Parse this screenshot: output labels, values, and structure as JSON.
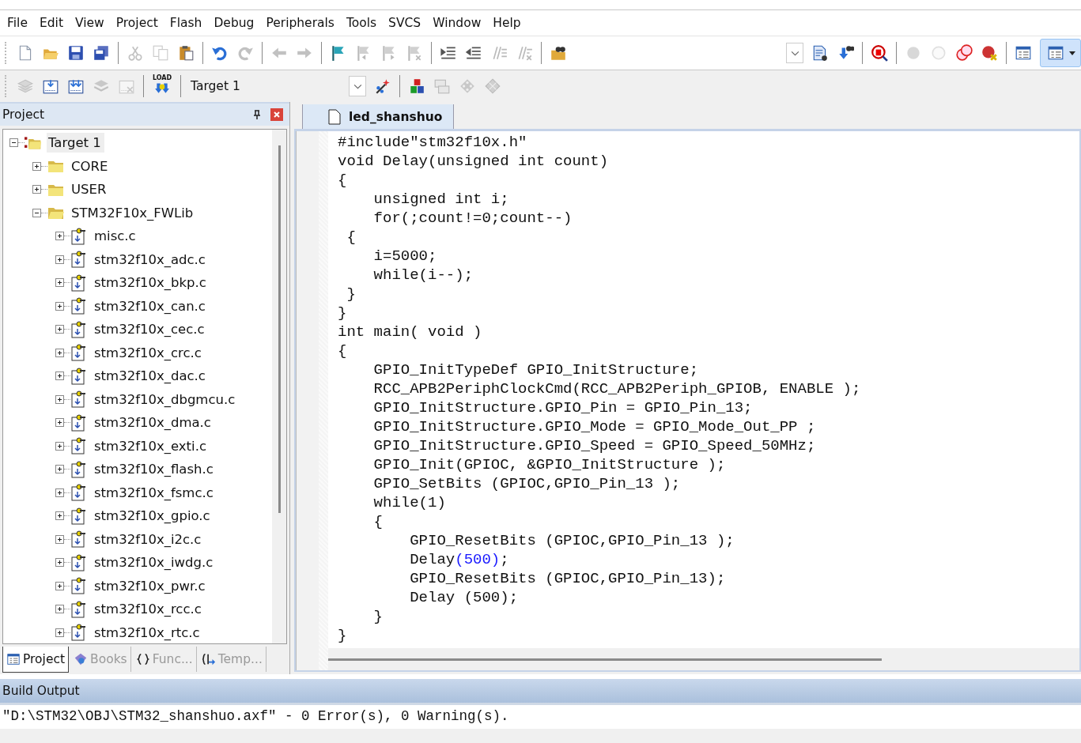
{
  "menu": [
    "File",
    "Edit",
    "View",
    "Project",
    "Flash",
    "Debug",
    "Peripherals",
    "Tools",
    "SVCS",
    "Window",
    "Help"
  ],
  "toolbar": {
    "main": [
      {
        "disabled": false
      },
      {
        "disabled": false
      },
      {
        "disabled": false
      },
      {
        "disabled": false
      },
      {
        "disabled": true
      },
      {
        "disabled": true
      },
      {
        "disabled": false
      },
      {
        "disabled": false
      },
      {
        "disabled": true
      },
      {
        "disabled": true
      },
      {
        "disabled": true
      },
      {
        "disabled": false
      },
      {
        "disabled": true
      },
      {
        "disabled": true
      },
      {
        "disabled": true
      },
      {
        "disabled": false
      },
      {
        "disabled": false
      },
      {
        "disabled": true
      },
      {
        "disabled": true
      },
      {
        "disabled": false
      }
    ],
    "right": [
      {
        "disabled": false
      },
      {
        "disabled": false
      },
      {
        "disabled": false
      },
      {
        "disabled": true
      },
      {
        "disabled": true
      },
      {
        "disabled": false
      },
      {
        "disabled": false
      },
      {
        "disabled": false
      }
    ],
    "build": [
      {
        "disabled": true
      },
      {
        "disabled": false
      },
      {
        "disabled": false
      },
      {
        "disabled": true
      },
      {
        "disabled": true
      }
    ],
    "load_label": "LOAD",
    "target": "Target 1",
    "tools": [
      {
        "disabled": false
      },
      {
        "disabled": false
      },
      {
        "disabled": true
      },
      {
        "disabled": true
      },
      {
        "disabled": true
      }
    ]
  },
  "project_panel": {
    "title": "Project",
    "tree": [
      {
        "label": "Target 1",
        "kind": "target",
        "expanded": true,
        "selected": true,
        "children": [
          {
            "label": "CORE",
            "kind": "folder",
            "expanded": false,
            "selected": false
          },
          {
            "label": "USER",
            "kind": "folder",
            "expanded": false,
            "selected": false
          },
          {
            "label": "STM32F10x_FWLib",
            "kind": "folder",
            "expanded": true,
            "selected": false,
            "children": [
              {
                "label": "misc.c",
                "kind": "file",
                "expanded": false,
                "selected": false
              },
              {
                "label": "stm32f10x_adc.c",
                "kind": "file",
                "expanded": false,
                "selected": false
              },
              {
                "label": "stm32f10x_bkp.c",
                "kind": "file",
                "expanded": false,
                "selected": false
              },
              {
                "label": "stm32f10x_can.c",
                "kind": "file",
                "expanded": false,
                "selected": false
              },
              {
                "label": "stm32f10x_cec.c",
                "kind": "file",
                "expanded": false,
                "selected": false
              },
              {
                "label": "stm32f10x_crc.c",
                "kind": "file",
                "expanded": false,
                "selected": false
              },
              {
                "label": "stm32f10x_dac.c",
                "kind": "file",
                "expanded": false,
                "selected": false
              },
              {
                "label": "stm32f10x_dbgmcu.c",
                "kind": "file",
                "expanded": false,
                "selected": false
              },
              {
                "label": "stm32f10x_dma.c",
                "kind": "file",
                "expanded": false,
                "selected": false
              },
              {
                "label": "stm32f10x_exti.c",
                "kind": "file",
                "expanded": false,
                "selected": false
              },
              {
                "label": "stm32f10x_flash.c",
                "kind": "file",
                "expanded": false,
                "selected": false
              },
              {
                "label": "stm32f10x_fsmc.c",
                "kind": "file",
                "expanded": false,
                "selected": false
              },
              {
                "label": "stm32f10x_gpio.c",
                "kind": "file",
                "expanded": false,
                "selected": false
              },
              {
                "label": "stm32f10x_i2c.c",
                "kind": "file",
                "expanded": false,
                "selected": false
              },
              {
                "label": "stm32f10x_iwdg.c",
                "kind": "file",
                "expanded": false,
                "selected": false
              },
              {
                "label": "stm32f10x_pwr.c",
                "kind": "file",
                "expanded": false,
                "selected": false
              },
              {
                "label": "stm32f10x_rcc.c",
                "kind": "file",
                "expanded": false,
                "selected": false
              },
              {
                "label": "stm32f10x_rtc.c",
                "kind": "file",
                "expanded": false,
                "selected": false
              }
            ]
          }
        ]
      }
    ],
    "tabs": [
      {
        "label": "Project",
        "selected": true
      },
      {
        "label": "Books",
        "selected": false
      },
      {
        "label": "Func...",
        "selected": false
      },
      {
        "label": "Temp...",
        "selected": false
      }
    ]
  },
  "editor": {
    "tabs": [
      {
        "label": "led_shanshuo",
        "selected": true
      }
    ],
    "lines": [
      [
        {
          "text": "#include\"stm32f10x.h\"",
          "kind": "plain"
        }
      ],
      [
        {
          "text": "void Delay(unsigned int count)",
          "kind": "plain"
        }
      ],
      [
        {
          "text": "{",
          "kind": "plain"
        }
      ],
      [
        {
          "text": "    unsigned int i;",
          "kind": "plain"
        }
      ],
      [
        {
          "text": "    for(;count!=0;count--)",
          "kind": "plain"
        }
      ],
      [
        {
          "text": " {",
          "kind": "plain"
        }
      ],
      [
        {
          "text": "    i=5000;",
          "kind": "plain"
        }
      ],
      [
        {
          "text": "    while(i--);",
          "kind": "plain"
        }
      ],
      [
        {
          "text": " }",
          "kind": "plain"
        }
      ],
      [
        {
          "text": "}",
          "kind": "plain"
        }
      ],
      [
        {
          "text": "int main( void )",
          "kind": "plain"
        }
      ],
      [
        {
          "text": "{",
          "kind": "plain"
        }
      ],
      [
        {
          "text": "    GPIO_InitTypeDef GPIO_InitStructure;",
          "kind": "plain"
        }
      ],
      [
        {
          "text": "    RCC_APB2PeriphClockCmd(RCC_APB2Periph_GPIOB, ENABLE );",
          "kind": "plain"
        }
      ],
      [
        {
          "text": "    GPIO_InitStructure.GPIO_Pin = GPIO_Pin_13;",
          "kind": "plain"
        }
      ],
      [
        {
          "text": "    GPIO_InitStructure.GPIO_Mode = GPIO_Mode_Out_PP ;",
          "kind": "plain"
        }
      ],
      [
        {
          "text": "    GPIO_InitStructure.GPIO_Speed = GPIO_Speed_50MHz;",
          "kind": "plain"
        }
      ],
      [
        {
          "text": "    GPIO_Init(GPIOC, &GPIO_InitStructure );",
          "kind": "plain"
        }
      ],
      [
        {
          "text": "    GPIO_SetBits (GPIOC,GPIO_Pin_13 );",
          "kind": "plain"
        }
      ],
      [
        {
          "text": "    while(1)",
          "kind": "plain"
        }
      ],
      [
        {
          "text": "    {",
          "kind": "plain"
        }
      ],
      [
        {
          "text": "        GPIO_ResetBits (GPIOC,GPIO_Pin_13 );",
          "kind": "plain"
        }
      ],
      [
        {
          "text": "        Delay",
          "kind": "plain"
        },
        {
          "text": "(500)",
          "kind": "number"
        },
        {
          "text": ";",
          "kind": "plain"
        }
      ],
      [
        {
          "text": "        GPIO_ResetBits (GPIOC,GPIO_Pin_13);",
          "kind": "plain"
        }
      ],
      [
        {
          "text": "        Delay (500);",
          "kind": "plain"
        }
      ],
      [
        {
          "text": "    }",
          "kind": "plain"
        }
      ],
      [
        {
          "text": "}",
          "kind": "plain"
        }
      ]
    ]
  },
  "build_output": {
    "title": "Build Output",
    "lines": [
      "\"D:\\STM32\\OBJ\\STM32_shanshuo.axf\" - 0 Error(s), 0 Warning(s)."
    ]
  }
}
